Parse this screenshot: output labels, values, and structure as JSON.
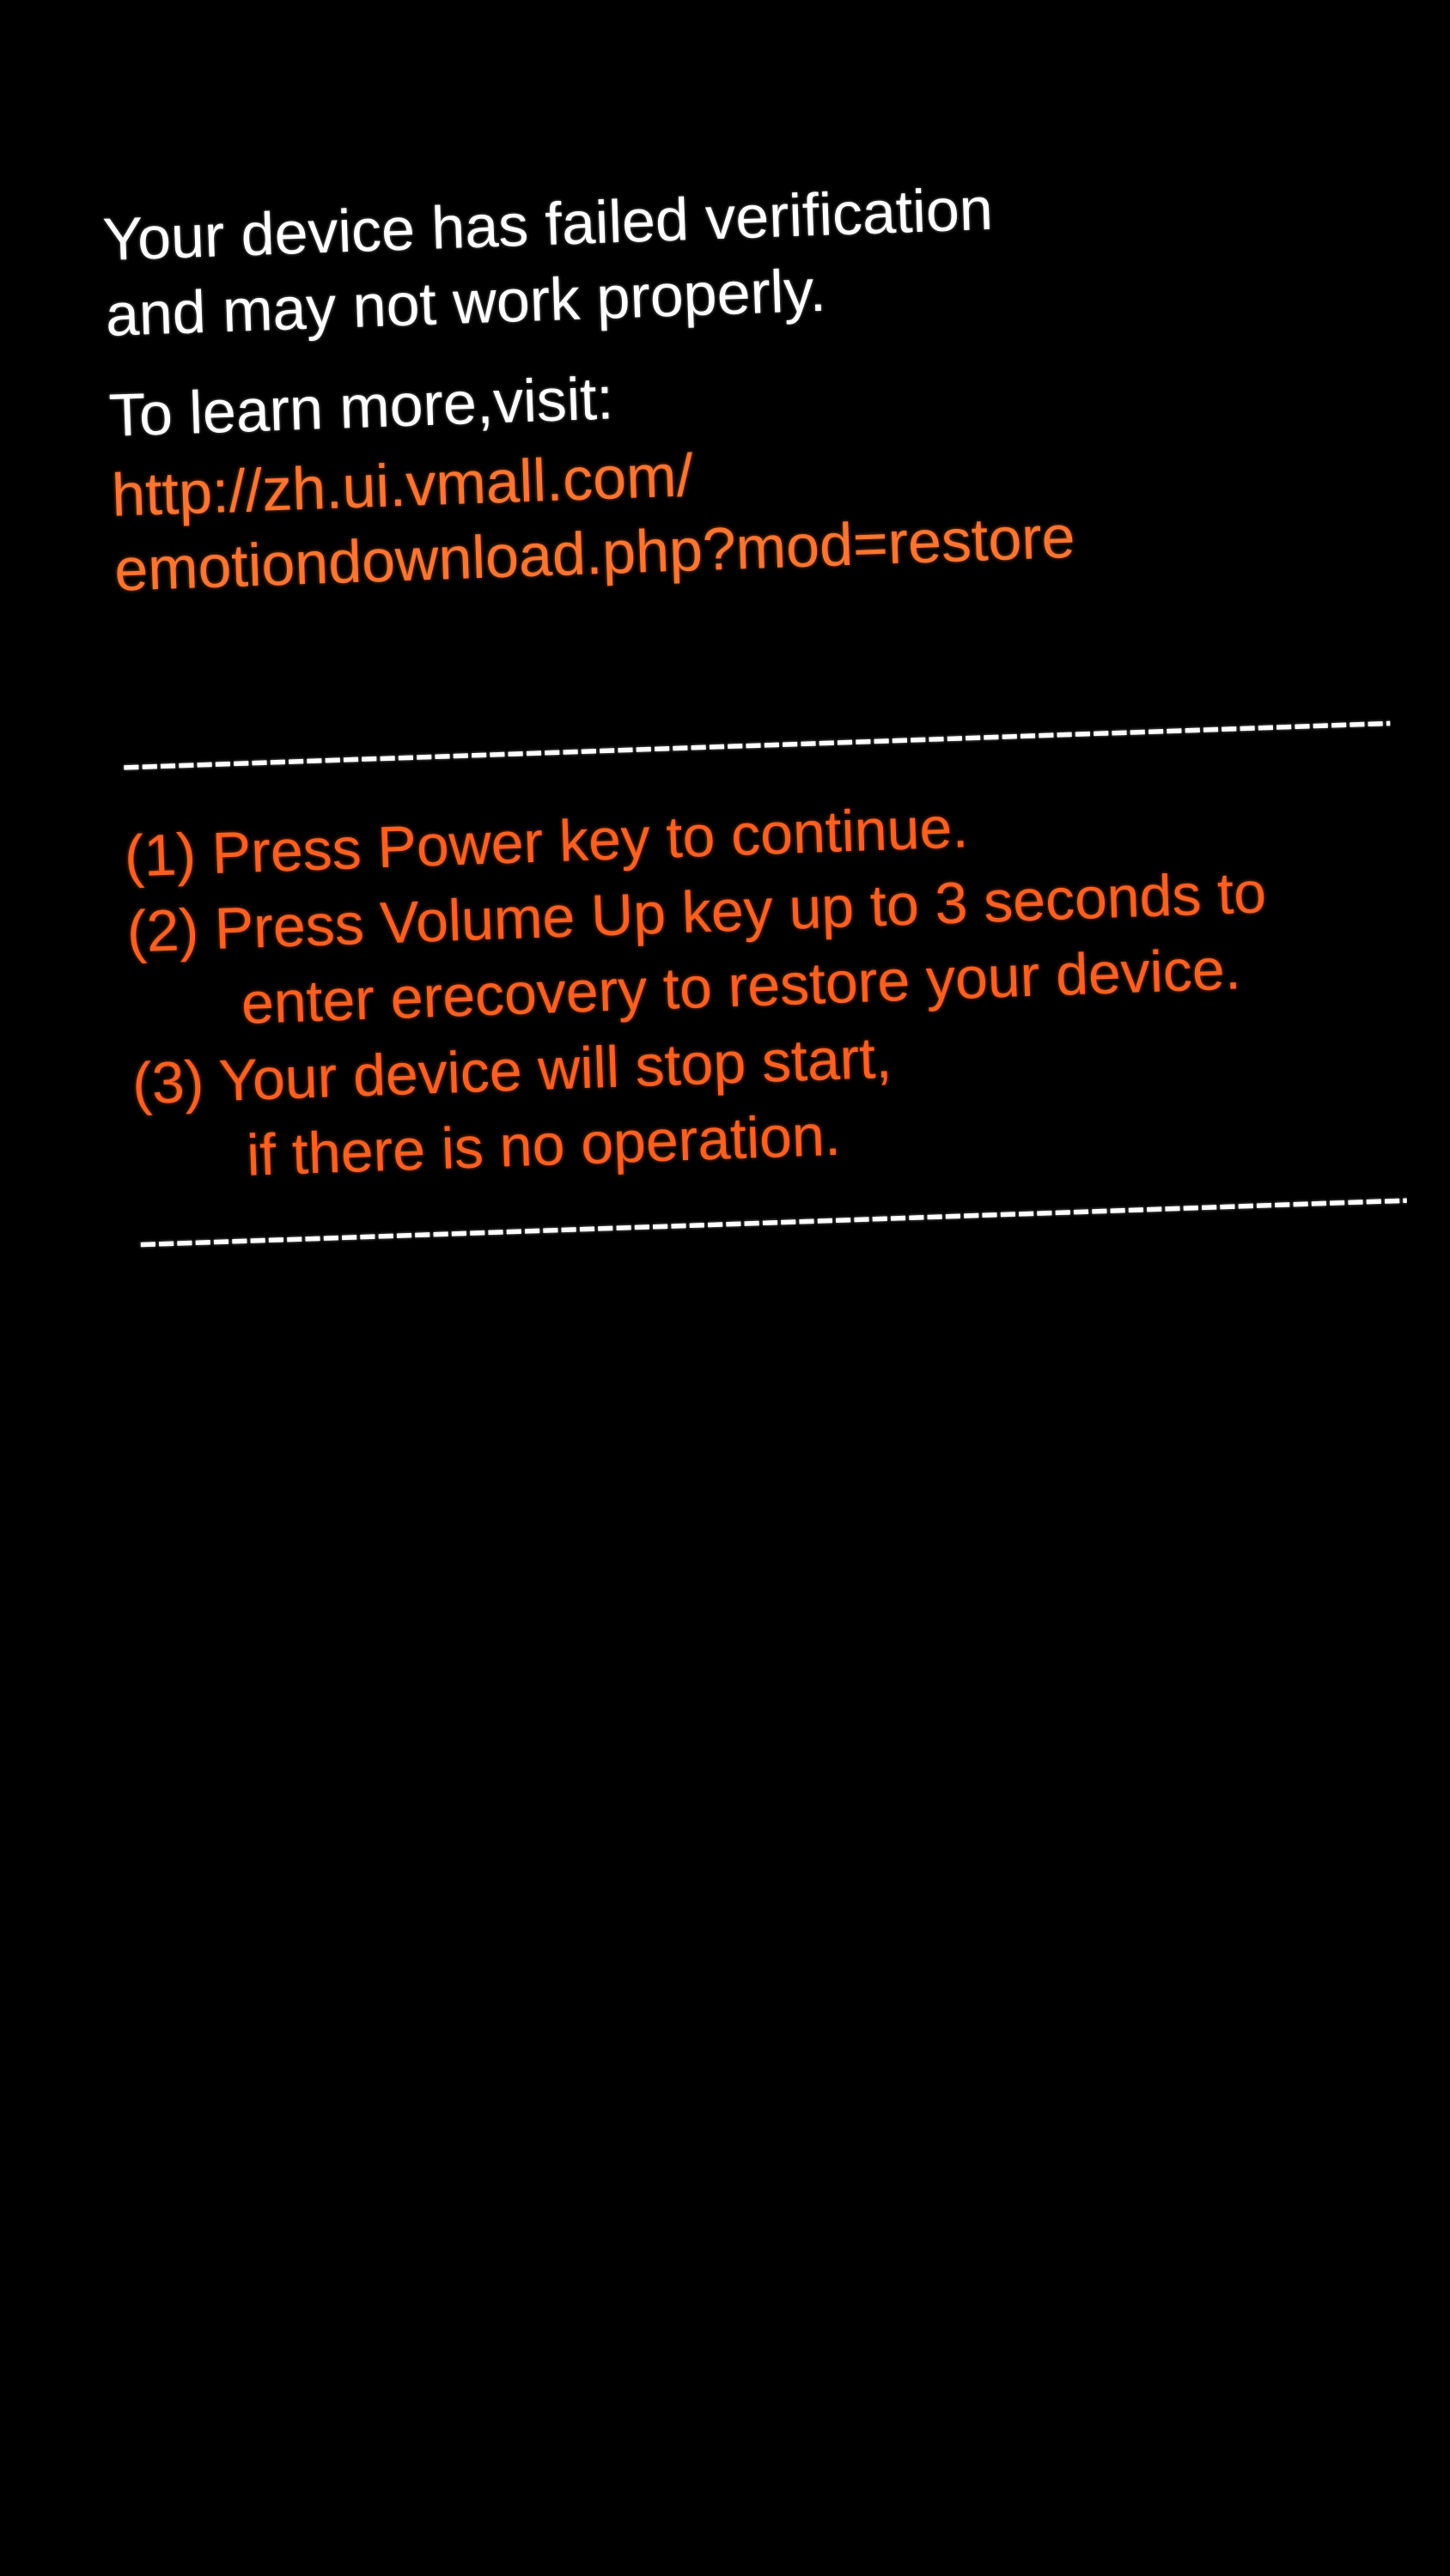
{
  "error": {
    "message_line1": "Your device has failed verification",
    "message_line2": "and may not work properly.",
    "learn_more": "To learn more,visit:",
    "url_line1": "http://zh.ui.vmall.com/",
    "url_line2": "emotiondownload.php?mod=restore"
  },
  "divider": "------------------------------------------------------------------------------",
  "instructions": {
    "item1": "(1) Press Power key to continue.",
    "item2_line1": "(2) Press Volume Up key up to 3 seconds to",
    "item2_line2": "enter erecovery to restore your device.",
    "item3_line1": "(3)  Your device will stop start,",
    "item3_line2": "if there is no operation."
  }
}
